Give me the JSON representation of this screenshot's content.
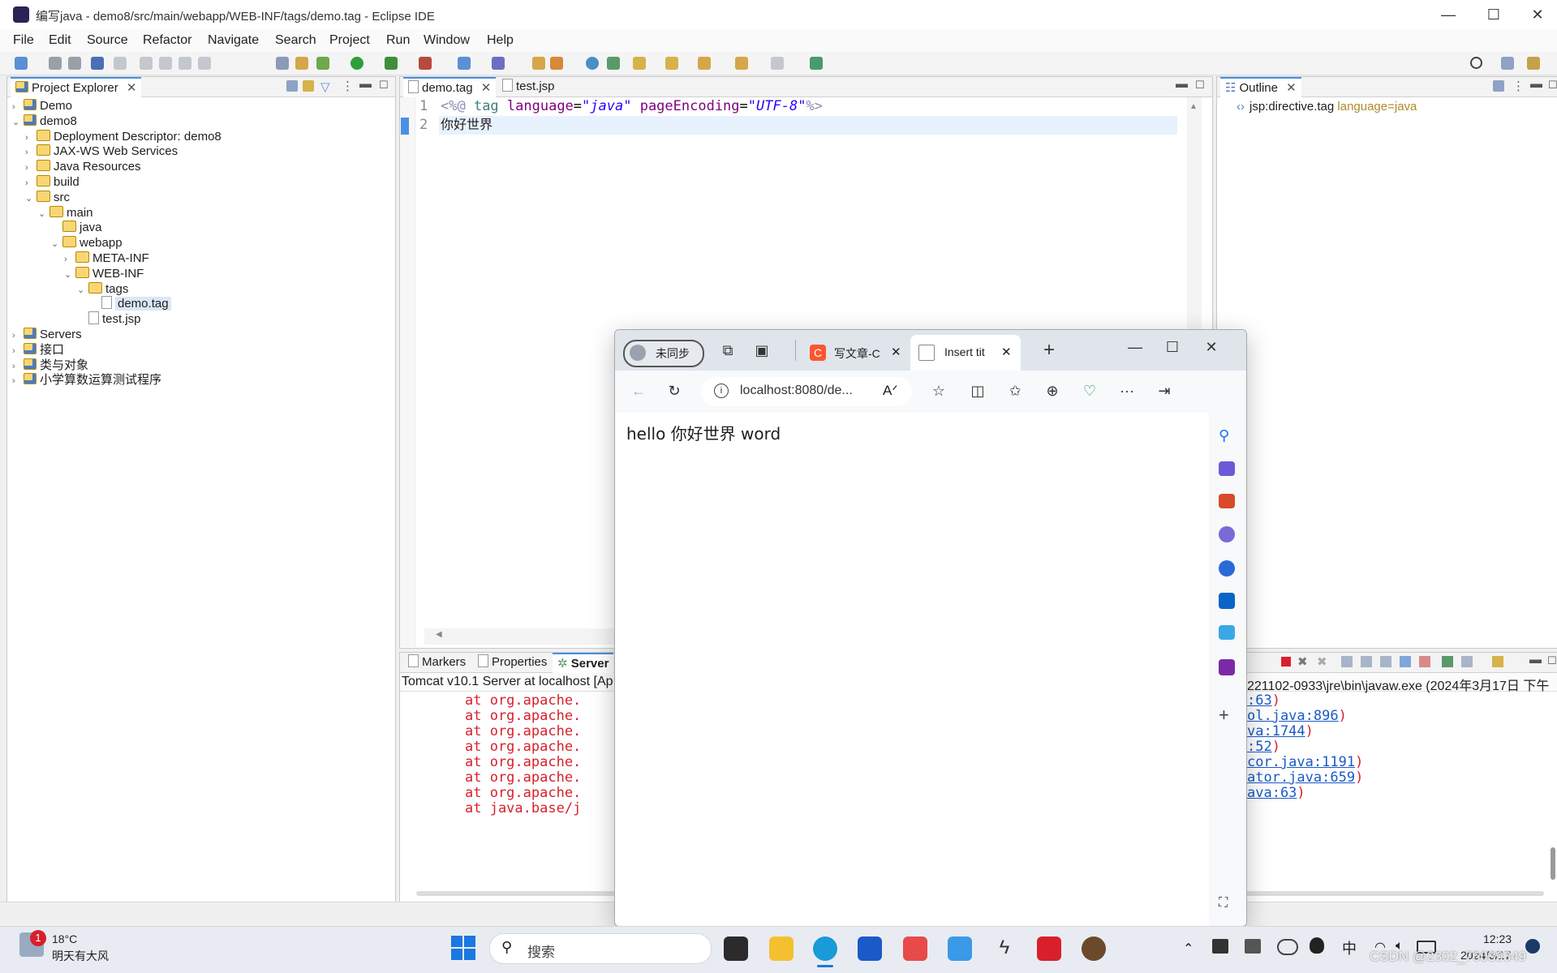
{
  "window": {
    "title": "编写java - demo8/src/main/webapp/WEB-INF/tags/demo.tag - Eclipse IDE",
    "minimize": "—",
    "maximize": "☐",
    "close": "✕"
  },
  "menu": [
    "File",
    "Edit",
    "Source",
    "Refactor",
    "Navigate",
    "Search",
    "Project",
    "Run",
    "Window",
    "Help"
  ],
  "project_explorer": {
    "tab": "Project Explorer",
    "items": [
      {
        "label": "Demo",
        "depth": 0,
        "chev": "›",
        "icon": "project"
      },
      {
        "label": "demo8",
        "depth": 0,
        "chev": "⌄",
        "icon": "project"
      },
      {
        "label": "Deployment Descriptor: demo8",
        "depth": 1,
        "chev": "›",
        "icon": "descriptor"
      },
      {
        "label": "JAX-WS Web Services",
        "depth": 1,
        "chev": "›",
        "icon": "service"
      },
      {
        "label": "Java Resources",
        "depth": 1,
        "chev": "›",
        "icon": "resources"
      },
      {
        "label": "build",
        "depth": 1,
        "chev": "›",
        "icon": "folder"
      },
      {
        "label": "src",
        "depth": 1,
        "chev": "⌄",
        "icon": "folder"
      },
      {
        "label": "main",
        "depth": 2,
        "chev": "⌄",
        "icon": "folder"
      },
      {
        "label": "java",
        "depth": 3,
        "chev": "",
        "icon": "folder"
      },
      {
        "label": "webapp",
        "depth": 3,
        "chev": "⌄",
        "icon": "folder"
      },
      {
        "label": "META-INF",
        "depth": 4,
        "chev": "›",
        "icon": "folder"
      },
      {
        "label": "WEB-INF",
        "depth": 4,
        "chev": "⌄",
        "icon": "folder"
      },
      {
        "label": "tags",
        "depth": 5,
        "chev": "⌄",
        "icon": "folder"
      },
      {
        "label": "demo.tag",
        "depth": 6,
        "chev": "",
        "icon": "file",
        "selected": true
      },
      {
        "label": "test.jsp",
        "depth": 5,
        "chev": "",
        "icon": "file"
      },
      {
        "label": "Servers",
        "depth": 0,
        "chev": "›",
        "icon": "project"
      },
      {
        "label": "接口",
        "depth": 0,
        "chev": "›",
        "icon": "project"
      },
      {
        "label": "类与对象",
        "depth": 0,
        "chev": "›",
        "icon": "project"
      },
      {
        "label": "小学算数运算测试程序",
        "depth": 0,
        "chev": "›",
        "icon": "project"
      }
    ]
  },
  "editor": {
    "tabs": [
      "demo.tag",
      "test.jsp"
    ],
    "lines": [
      {
        "num": "1",
        "parts": [
          {
            "t": "<%@ ",
            "c": "#8c8cb4"
          },
          {
            "t": "tag ",
            "c": "#3f7f7f"
          },
          {
            "t": "language",
            "c": "#7f007f"
          },
          {
            "t": "=",
            "c": "#000"
          },
          {
            "t": "\"java\"",
            "c": "#2a00ff",
            "i": true
          },
          {
            "t": " pageEncoding",
            "c": "#7f007f"
          },
          {
            "t": "=",
            "c": "#000"
          },
          {
            "t": "\"UTF-8\"",
            "c": "#2a00ff",
            "i": true
          },
          {
            "t": "%>",
            "c": "#8c8cb4"
          }
        ]
      },
      {
        "num": "2",
        "text": "你好世界"
      }
    ]
  },
  "outline": {
    "tab": "Outline",
    "item_prefix": "jsp:directive.tag",
    "item_suffix": "language=java"
  },
  "bottom": {
    "tabs": [
      "Markers",
      "Properties",
      "Server"
    ],
    "server_line": "Tomcat v10.1 Server at localhost [Ap",
    "jre_line": "221102-0933\\jre\\bin\\javaw.exe  (2024年3月17日 下午",
    "console_left": [
      "at org.apache.",
      "at org.apache.",
      "at org.apache.",
      "at org.apache.",
      "at org.apache.",
      "at org.apache.",
      "at org.apache.",
      "at java.base/j"
    ],
    "console_right": [
      ":63)",
      "ol.java:896)",
      "va:1744)",
      ":52)",
      "cor.java:1191)",
      "ator.java:659)",
      "ava:63)"
    ]
  },
  "browser": {
    "profile": "未同步",
    "tab1": "写文章-C",
    "tab2": "Insert tit",
    "url": "localhost:8080/de...",
    "content": "hello 你好世界 word"
  },
  "taskbar": {
    "weather_temp": "18°C",
    "weather_desc": "明天有大风",
    "badge": "1",
    "search": "搜索",
    "time": "12:23",
    "date": "2024/3/17",
    "ime": "中",
    "watermark": "CSDN @2302_76039349"
  }
}
